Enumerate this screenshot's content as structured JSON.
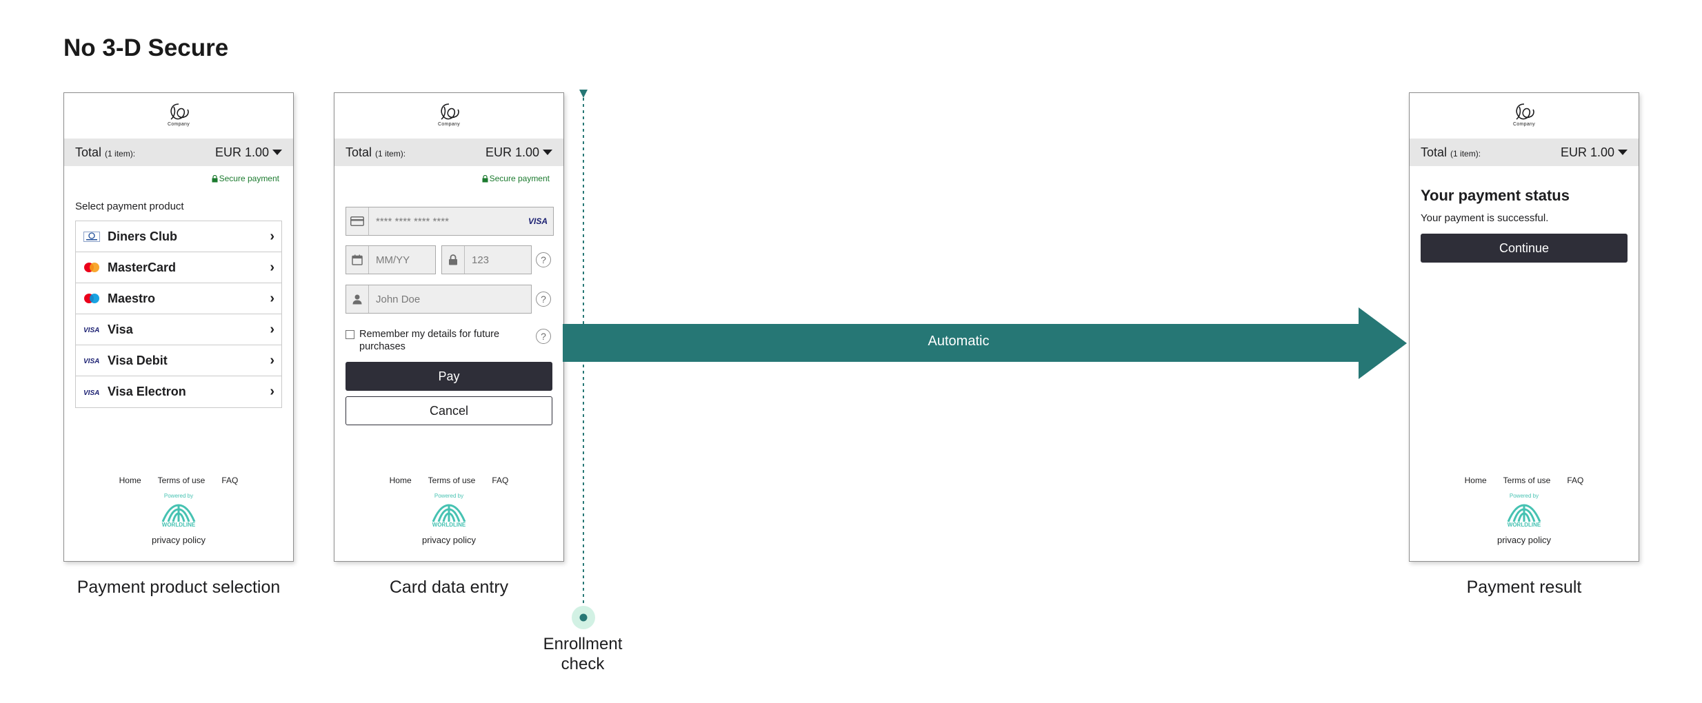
{
  "title": "No 3-D Secure",
  "colors": {
    "accent": "#267775",
    "dark_button": "#2e2e38",
    "secure_green": "#1b7a2e",
    "worldline": "#46c2b2"
  },
  "common": {
    "company": "Company",
    "total_label": "Total",
    "total_items": "(1 item):",
    "amount": "EUR 1.00",
    "secure": "Secure payment",
    "footer_links": [
      "Home",
      "Terms of use",
      "FAQ"
    ],
    "powered_by": "Powered by",
    "worldline": "WORLDLINE",
    "privacy": "privacy policy"
  },
  "screen1": {
    "caption": "Payment product selection",
    "heading": "Select payment product",
    "products": [
      {
        "name": "Diners Club",
        "icon": "diners-club-icon"
      },
      {
        "name": "MasterCard",
        "icon": "mastercard-icon"
      },
      {
        "name": "Maestro",
        "icon": "maestro-icon"
      },
      {
        "name": "Visa",
        "icon": "visa-icon"
      },
      {
        "name": "Visa Debit",
        "icon": "visa-icon"
      },
      {
        "name": "Visa Electron",
        "icon": "visa-icon"
      }
    ]
  },
  "screen2": {
    "caption": "Card data entry",
    "card_placeholder": "**** **** **** ****",
    "card_brand": "VISA",
    "expiry_placeholder": "MM/YY",
    "cvv_placeholder": "123",
    "name_placeholder": "John Doe",
    "help": "?",
    "remember": "Remember my details for future purchases",
    "pay": "Pay",
    "cancel": "Cancel"
  },
  "screen3": {
    "caption": "Payment result",
    "status_heading": "Your payment status",
    "status_text": "Your payment is successful.",
    "continue": "Continue"
  },
  "flow": {
    "arrow_label": "Automatic",
    "enrollment_label_1": "Enrollment",
    "enrollment_label_2": "check"
  }
}
